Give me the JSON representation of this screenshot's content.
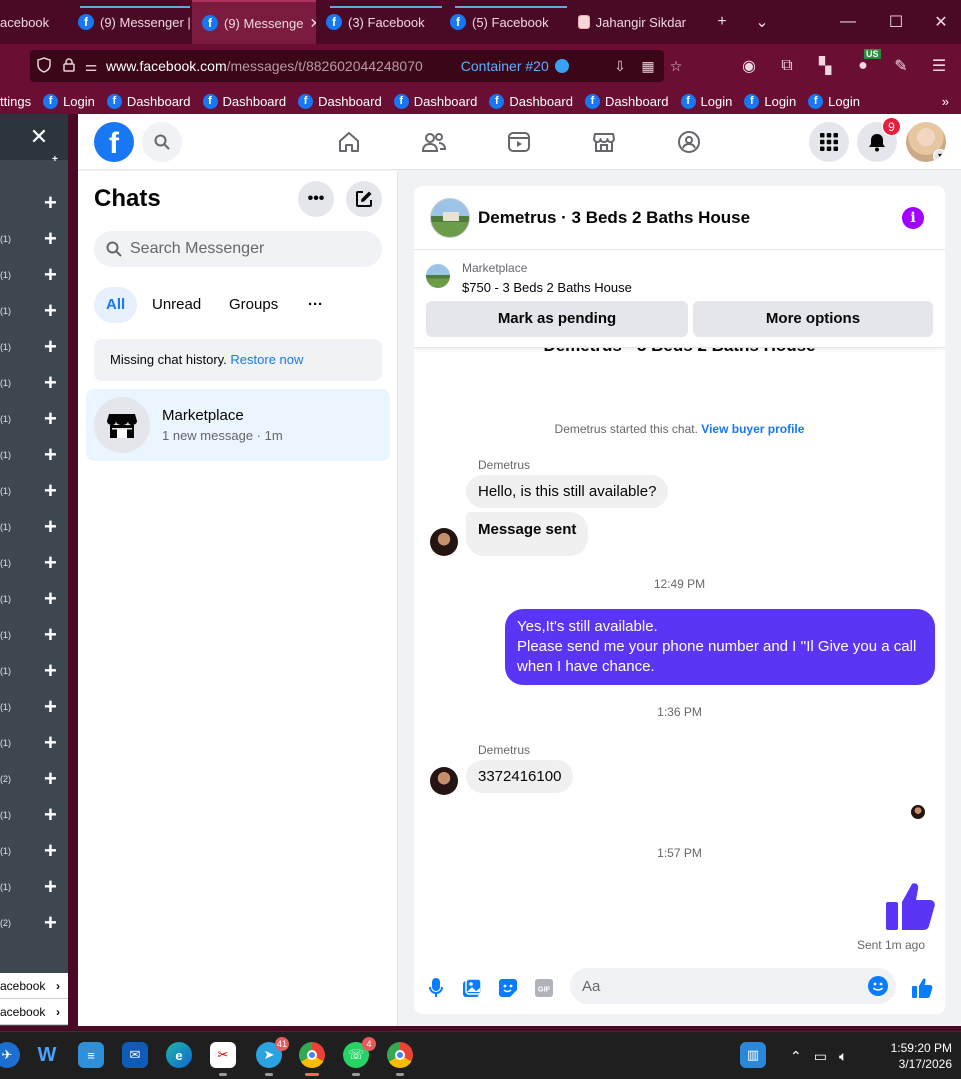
{
  "browser": {
    "tabs": [
      {
        "label": "acebook",
        "active": false
      },
      {
        "label": "(9) Messenger |",
        "active": false
      },
      {
        "label": "(9) Messenge",
        "active": true
      },
      {
        "label": "(3) Facebook",
        "active": false
      },
      {
        "label": "(5) Facebook",
        "active": false
      },
      {
        "label": "Jahangir Sikdar",
        "active": false
      }
    ],
    "url_host": "www.facebook.com",
    "url_path": "/messages/t/882602044248070",
    "container_label": "Container #20",
    "vpn_badge": "US",
    "bookmarks": [
      "ttings",
      "Login",
      "Dashboard",
      "Dashboard",
      "Dashboard",
      "Dashboard",
      "Dashboard",
      "Dashboard",
      "Login",
      "Login",
      "Login"
    ]
  },
  "left_panel": {
    "counts": [
      "",
      "",
      "(1)",
      "(1)",
      "(1)",
      "(1)",
      "(1)",
      "(1)",
      "(1)",
      "(1)",
      "(1)",
      "(1)",
      "(1)",
      "(1)",
      "(1)",
      "(1)",
      "(1)",
      "(2)",
      "(1)",
      "(1)",
      "(1)",
      "(2)"
    ],
    "links": [
      "acebook",
      "acebook"
    ]
  },
  "fb": {
    "notif_count": "9",
    "chats": {
      "title": "Chats",
      "search_placeholder": "Search Messenger",
      "filters": [
        "All",
        "Unread",
        "Groups"
      ],
      "notice_text": "Missing chat history.",
      "notice_link": "Restore now",
      "item": {
        "name": "Marketplace",
        "sub": "1 new message · 1m"
      }
    },
    "conversation": {
      "title": "Demetrus · 3 Beds 2 Baths House",
      "marketplace_label": "Marketplace",
      "listing": "$750 - 3 Beds 2 Baths House",
      "btn_pending": "Mark as pending",
      "btn_more": "More options",
      "ghost_title": "Demetrus · 3 Beds 2 Baths House",
      "started_text": "Demetrus started this chat.",
      "started_link": "View buyer profile",
      "sender": "Demetrus",
      "msg1": "Hello, is this still available?",
      "msg2": "Message sent",
      "time1": "12:49 PM",
      "out_line1": "Yes,It's still available.",
      "out_line2": "Please send me your phone number and I ''Il Give you a call when I have chance.",
      "time2": "1:36 PM",
      "msg3": "3372416100",
      "time3": "1:57 PM",
      "sent_status": "Sent 1m ago",
      "composer_placeholder": "Aa"
    }
  },
  "taskbar": {
    "badges": {
      "telegram": "41",
      "whatsapp": "4"
    },
    "time": "1:59:20 PM",
    "date": "3/17/2026"
  }
}
